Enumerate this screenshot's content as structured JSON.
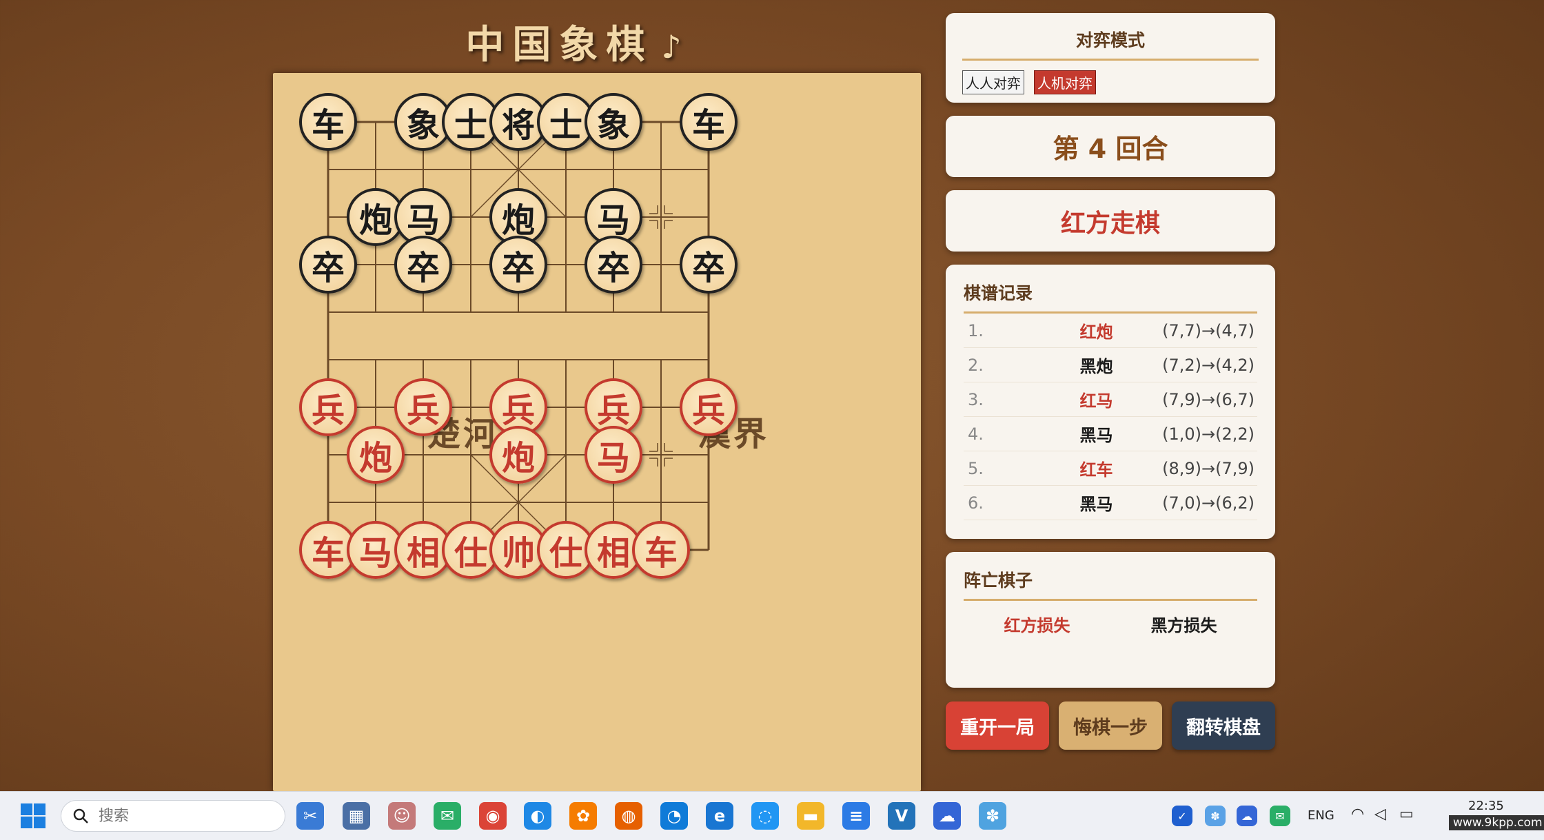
{
  "title": "中国象棋",
  "music_icon": "♪",
  "river": {
    "left": "楚河",
    "right": "漢界"
  },
  "board": {
    "cols": 9,
    "rows": 10,
    "markers": [
      [
        7,
        2
      ],
      [
        7,
        7
      ]
    ],
    "pieces": [
      {
        "char": "车",
        "side": "black",
        "col": 0,
        "row": 0
      },
      {
        "char": "象",
        "side": "black",
        "col": 2,
        "row": 0
      },
      {
        "char": "士",
        "side": "black",
        "col": 3,
        "row": 0
      },
      {
        "char": "将",
        "side": "black",
        "col": 4,
        "row": 0
      },
      {
        "char": "士",
        "side": "black",
        "col": 5,
        "row": 0
      },
      {
        "char": "象",
        "side": "black",
        "col": 6,
        "row": 0
      },
      {
        "char": "车",
        "side": "black",
        "col": 8,
        "row": 0
      },
      {
        "char": "炮",
        "side": "black",
        "col": 1,
        "row": 2
      },
      {
        "char": "马",
        "side": "black",
        "col": 2,
        "row": 2
      },
      {
        "char": "炮",
        "side": "black",
        "col": 4,
        "row": 2
      },
      {
        "char": "马",
        "side": "black",
        "col": 6,
        "row": 2
      },
      {
        "char": "卒",
        "side": "black",
        "col": 0,
        "row": 3
      },
      {
        "char": "卒",
        "side": "black",
        "col": 2,
        "row": 3
      },
      {
        "char": "卒",
        "side": "black",
        "col": 4,
        "row": 3
      },
      {
        "char": "卒",
        "side": "black",
        "col": 6,
        "row": 3
      },
      {
        "char": "卒",
        "side": "black",
        "col": 8,
        "row": 3
      },
      {
        "char": "兵",
        "side": "red",
        "col": 0,
        "row": 6
      },
      {
        "char": "兵",
        "side": "red",
        "col": 2,
        "row": 6
      },
      {
        "char": "兵",
        "side": "red",
        "col": 4,
        "row": 6
      },
      {
        "char": "兵",
        "side": "red",
        "col": 6,
        "row": 6
      },
      {
        "char": "兵",
        "side": "red",
        "col": 8,
        "row": 6
      },
      {
        "char": "炮",
        "side": "red",
        "col": 1,
        "row": 7
      },
      {
        "char": "炮",
        "side": "red",
        "col": 4,
        "row": 7
      },
      {
        "char": "马",
        "side": "red",
        "col": 6,
        "row": 7
      },
      {
        "char": "车",
        "side": "red",
        "col": 0,
        "row": 9
      },
      {
        "char": "马",
        "side": "red",
        "col": 1,
        "row": 9
      },
      {
        "char": "相",
        "side": "red",
        "col": 2,
        "row": 9
      },
      {
        "char": "仕",
        "side": "red",
        "col": 3,
        "row": 9
      },
      {
        "char": "帅",
        "side": "red",
        "col": 4,
        "row": 9
      },
      {
        "char": "仕",
        "side": "red",
        "col": 5,
        "row": 9
      },
      {
        "char": "相",
        "side": "red",
        "col": 6,
        "row": 9
      },
      {
        "char": "车",
        "side": "red",
        "col": 7,
        "row": 9
      }
    ]
  },
  "mode": {
    "heading": "对弈模式",
    "options": [
      "人人对弈",
      "人机对弈"
    ],
    "active": 1
  },
  "round_label": "第 4 回合",
  "turn_label": "红方走棋",
  "record": {
    "heading": "棋谱记录",
    "moves": [
      {
        "num": "1.",
        "piece": "红炮",
        "side": "red",
        "move": "(7,7)→(4,7)"
      },
      {
        "num": "2.",
        "piece": "黑炮",
        "side": "black",
        "move": "(7,2)→(4,2)"
      },
      {
        "num": "3.",
        "piece": "红马",
        "side": "red",
        "move": "(7,9)→(6,7)"
      },
      {
        "num": "4.",
        "piece": "黑马",
        "side": "black",
        "move": "(1,0)→(2,2)"
      },
      {
        "num": "5.",
        "piece": "红车",
        "side": "red",
        "move": "(8,9)→(7,9)"
      },
      {
        "num": "6.",
        "piece": "黑马",
        "side": "black",
        "move": "(7,0)→(6,2)"
      }
    ]
  },
  "captured": {
    "heading": "阵亡棋子",
    "red_label": "红方损失",
    "black_label": "黑方损失"
  },
  "buttons": {
    "restart": "重开一局",
    "undo": "悔棋一步",
    "flip": "翻转棋盘"
  },
  "taskbar": {
    "search_placeholder": "搜索",
    "lang": "ENG",
    "time": "22:35",
    "watermark": "www.9kpp.com",
    "icons": [
      {
        "name": "snipping-tool-icon",
        "glyph": "✂",
        "color": "#3a7bd5"
      },
      {
        "name": "calculator-icon",
        "glyph": "▦",
        "color": "#4a6fa5"
      },
      {
        "name": "avatar-app-icon",
        "glyph": "☺",
        "color": "#c47a7a"
      },
      {
        "name": "wechat-icon",
        "glyph": "✉",
        "color": "#2aae67"
      },
      {
        "name": "chrome-icon",
        "glyph": "◉",
        "color": "#db4437"
      },
      {
        "name": "browser-blue-icon",
        "glyph": "◐",
        "color": "#1e88e5"
      },
      {
        "name": "orange-app-icon",
        "glyph": "✿",
        "color": "#f57c00"
      },
      {
        "name": "firefox-icon",
        "glyph": "◍",
        "color": "#e66000"
      },
      {
        "name": "edge-icon",
        "glyph": "◔",
        "color": "#0f7bd8"
      },
      {
        "name": "ie-icon",
        "glyph": "e",
        "color": "#1976d2"
      },
      {
        "name": "chat-app-icon",
        "glyph": "◌",
        "color": "#2196f3"
      },
      {
        "name": "file-explorer-icon",
        "glyph": "▬",
        "color": "#f2b72a"
      },
      {
        "name": "notepad-icon",
        "glyph": "≡",
        "color": "#2c7be5"
      },
      {
        "name": "vscode-icon",
        "glyph": "V",
        "color": "#2373b9"
      },
      {
        "name": "cloud-app-icon",
        "glyph": "☁",
        "color": "#3466d6"
      },
      {
        "name": "colorful-app-icon",
        "glyph": "✽",
        "color": "#4fa3e0"
      }
    ]
  },
  "colors": {
    "red": "#c43a2e",
    "black": "#1a1a1a",
    "board": "#e9c88c",
    "line": "#6b4a28"
  }
}
